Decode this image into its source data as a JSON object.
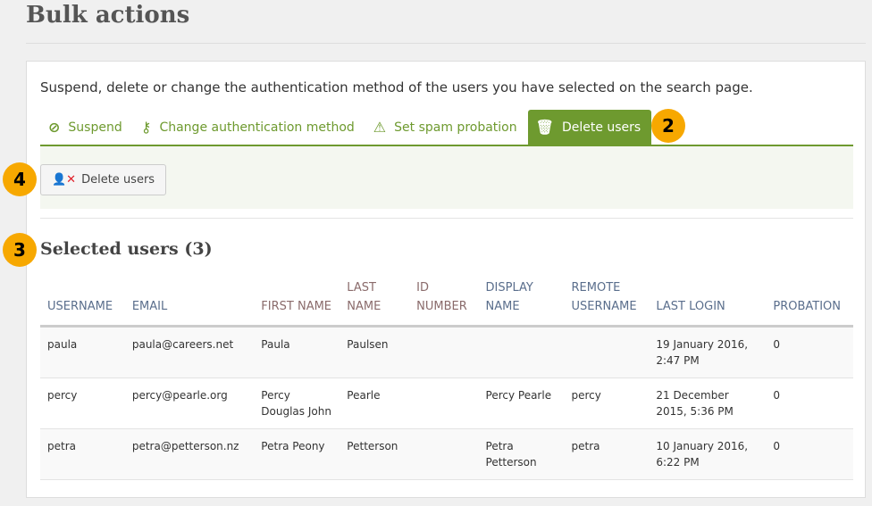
{
  "title": "Bulk actions",
  "description": "Suspend, delete or change the authentication method of the users you have selected on the search page.",
  "tabs": [
    {
      "label": "Suspend",
      "icon": "ban-icon"
    },
    {
      "label": "Change authentication method",
      "icon": "key-icon"
    },
    {
      "label": "Set spam probation",
      "icon": "warning-icon"
    },
    {
      "label": "Delete users",
      "icon": "trash-icon",
      "active": true
    }
  ],
  "delete_button": "Delete users",
  "section_title": "Selected users (3)",
  "callouts": {
    "tab": "2",
    "heading": "3",
    "button": "4"
  },
  "columns": [
    [
      "USERNAME",
      ""
    ],
    [
      "EMAIL",
      ""
    ],
    [
      "FIRST NAME",
      ""
    ],
    [
      "LAST",
      "NAME"
    ],
    [
      "ID",
      "NUMBER"
    ],
    [
      "DISPLAY",
      "NAME"
    ],
    [
      "REMOTE",
      "USERNAME"
    ],
    [
      "LAST LOGIN",
      ""
    ],
    [
      "PROBATION",
      ""
    ]
  ],
  "rows": [
    [
      "paula",
      "paula@careers.net",
      "Paula",
      "Paulsen",
      "",
      "",
      "",
      "19 January 2016, 2:47 PM",
      "0"
    ],
    [
      "percy",
      "percy@pearle.org",
      "Percy Douglas John",
      "Pearle",
      "",
      "Percy Pearle",
      "percy",
      "21 December 2015, 5:36 PM",
      "0"
    ],
    [
      "petra",
      "petra@petterson.nz",
      "Petra Peony",
      "Petterson",
      "",
      "Petra Petterson",
      "petra",
      "10 January 2016, 6:22 PM",
      "0"
    ]
  ],
  "colors": {
    "accent": "#6e9a2f",
    "callout": "#f7a800",
    "danger": "#e0202a"
  }
}
